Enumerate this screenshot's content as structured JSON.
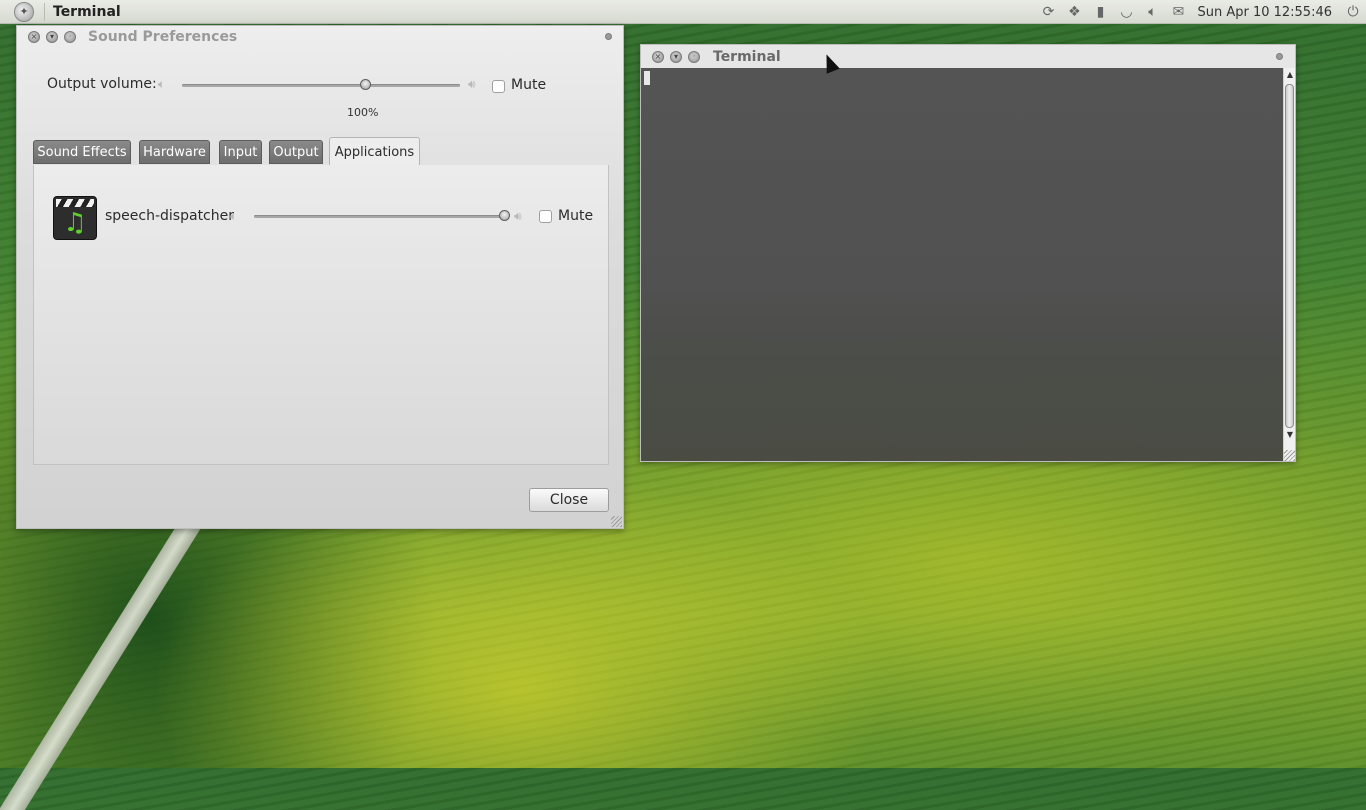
{
  "top_panel": {
    "title": "Terminal",
    "clock": "Sun Apr 10 12:55:46",
    "tray_icons": [
      "network-sync-icon",
      "dropbox-icon",
      "battery-icon",
      "wifi-icon",
      "volume-icon",
      "mail-icon",
      "power-icon"
    ]
  },
  "sound_window": {
    "title": "Sound Preferences",
    "output_volume_label": "Output volume:",
    "output_volume_percent_label": "100%",
    "output_volume_level": 0.66,
    "mute_label": "Mute",
    "mute_checked": false,
    "tabs": [
      {
        "label": "Sound Effects",
        "active": false
      },
      {
        "label": "Hardware",
        "active": false
      },
      {
        "label": "Input",
        "active": false
      },
      {
        "label": "Output",
        "active": false
      },
      {
        "label": "Applications",
        "active": true
      }
    ],
    "applications": [
      {
        "name": "speech-dispatcher",
        "volume_level": 1.0,
        "mute_label": "Mute",
        "mute_checked": false
      }
    ],
    "close_button": "Close"
  },
  "terminal_window": {
    "title": "Terminal"
  }
}
